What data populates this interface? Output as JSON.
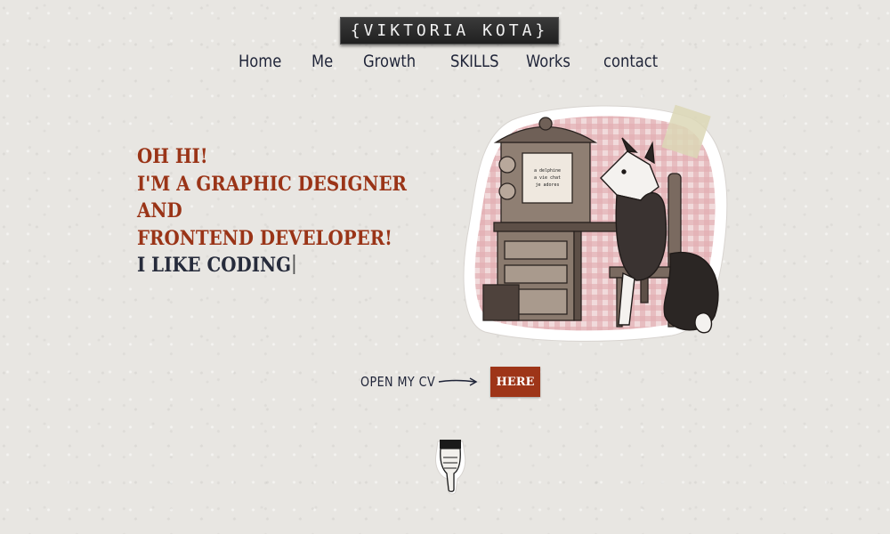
{
  "brand": {
    "logo_text": "{VIKTORIA KOTA}"
  },
  "nav": {
    "items": [
      {
        "label": "Home"
      },
      {
        "label": "Me"
      },
      {
        "label": "Growth"
      },
      {
        "label": "SKILLS"
      },
      {
        "label": "Works"
      },
      {
        "label": "contact"
      }
    ]
  },
  "hero": {
    "lines": [
      "OH HI!",
      "I'M A GRAPHIC DESIGNER",
      "AND",
      "FRONTEND DEVELOPER!"
    ],
    "typed_text": "I LIKE CODING"
  },
  "illustration": {
    "screen_text": [
      "a delphine",
      "a vie chat",
      "je adores"
    ]
  },
  "cv": {
    "label": "OPEN MY CV",
    "button_label": "HERE"
  },
  "icons": {
    "scroll": "pointing-hand-icon",
    "arrow": "arrow-right-icon"
  },
  "colors": {
    "accent": "#9e3518",
    "ink": "#1f2438",
    "paper": "#e8e6e2",
    "blush": "#e8b9bd"
  }
}
